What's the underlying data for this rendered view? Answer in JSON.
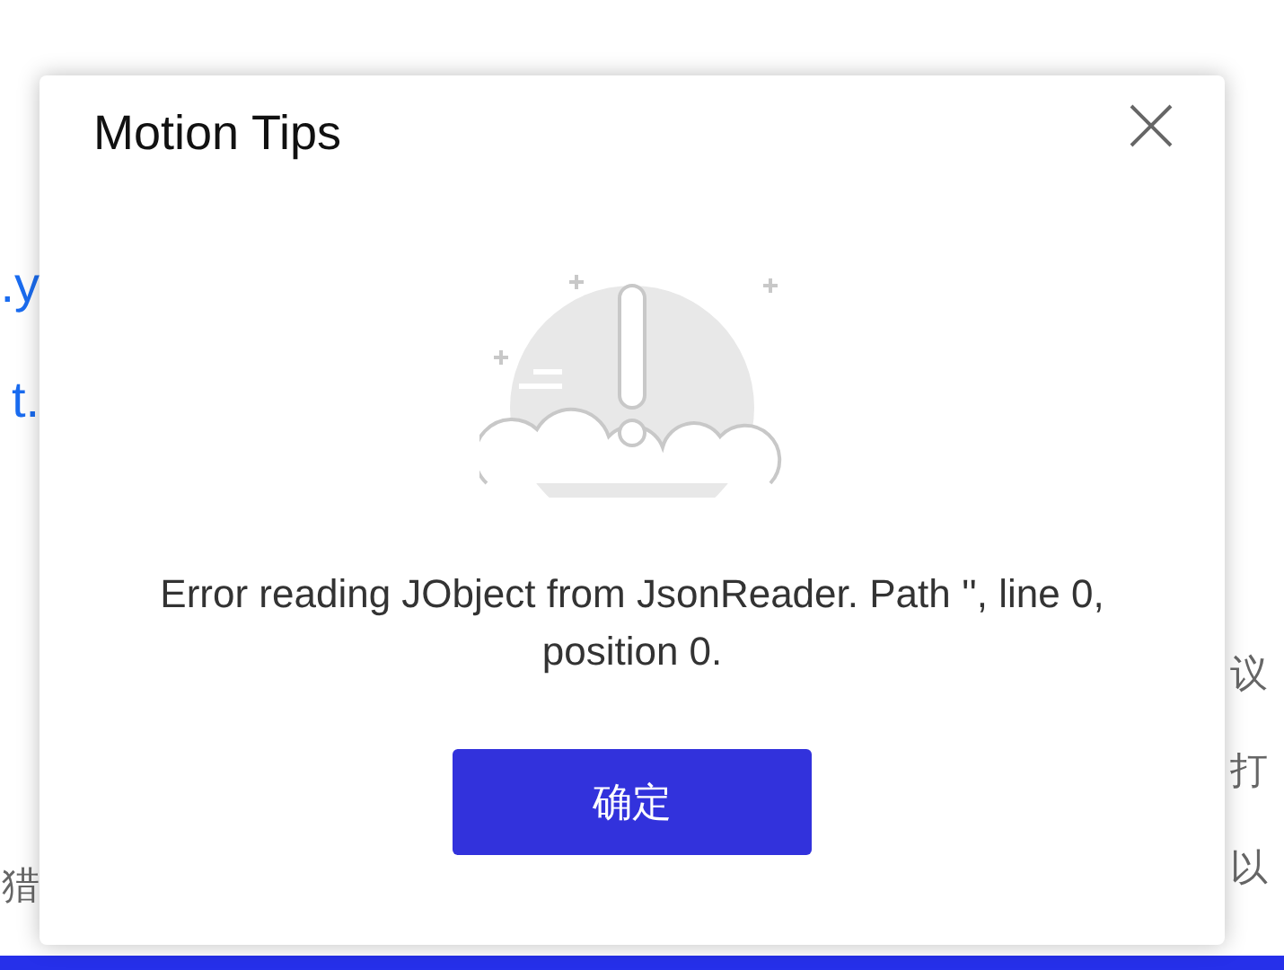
{
  "background_page": {
    "left_links": [
      ".y",
      "t."
    ],
    "left_text": [
      "猎"
    ],
    "right_text": [
      "议",
      "打",
      "以"
    ]
  },
  "dialog": {
    "title": "Motion Tips",
    "message": "Error reading JObject from JsonReader. Path '', line 0, position 0.",
    "button": "确定"
  }
}
